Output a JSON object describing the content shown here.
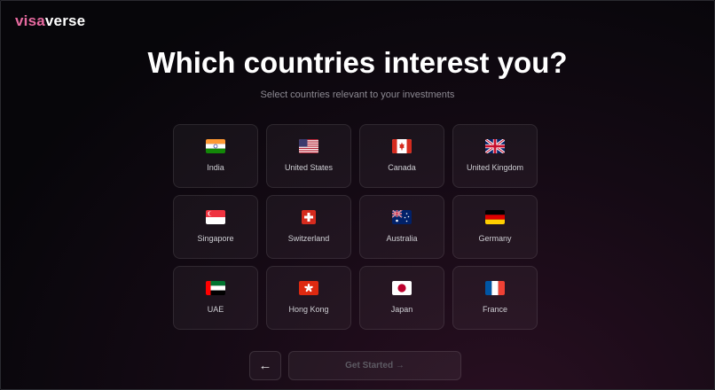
{
  "brand": {
    "part1": "visa",
    "part2": "verse",
    "accent_color": "#e76aa0"
  },
  "heading": {
    "title": "Which countries interest you?",
    "subtitle": "Select countries relevant to your investments"
  },
  "countries": [
    {
      "label": "India",
      "flag_icon": "india-flag-icon"
    },
    {
      "label": "United States",
      "flag_icon": "united-states-flag-icon"
    },
    {
      "label": "Canada",
      "flag_icon": "canada-flag-icon"
    },
    {
      "label": "United Kingdom",
      "flag_icon": "united-kingdom-flag-icon"
    },
    {
      "label": "Singapore",
      "flag_icon": "singapore-flag-icon"
    },
    {
      "label": "Switzerland",
      "flag_icon": "switzerland-flag-icon"
    },
    {
      "label": "Australia",
      "flag_icon": "australia-flag-icon"
    },
    {
      "label": "Germany",
      "flag_icon": "germany-flag-icon"
    },
    {
      "label": "UAE",
      "flag_icon": "uae-flag-icon"
    },
    {
      "label": "Hong Kong",
      "flag_icon": "hong-kong-flag-icon"
    },
    {
      "label": "Japan",
      "flag_icon": "japan-flag-icon"
    },
    {
      "label": "France",
      "flag_icon": "france-flag-icon"
    }
  ],
  "footer": {
    "back_label": "←",
    "start_label": "Get Started →"
  }
}
